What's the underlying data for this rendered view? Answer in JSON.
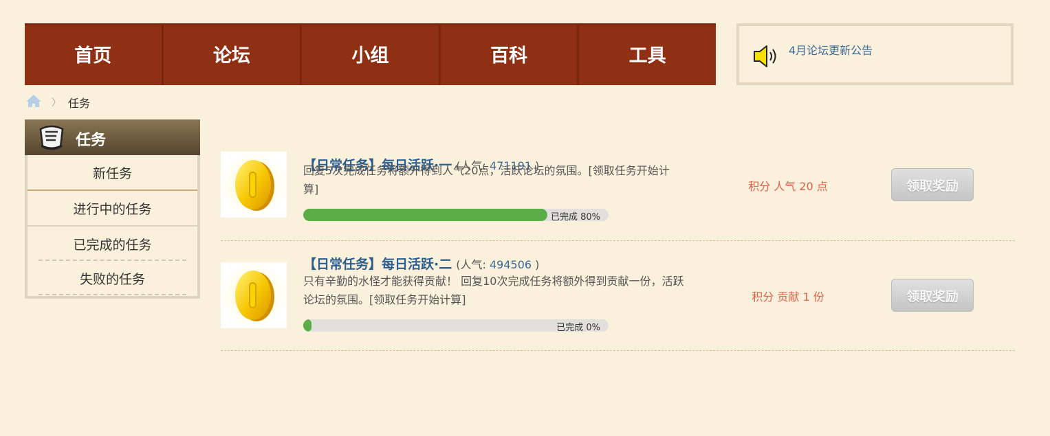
{
  "nav": {
    "items": [
      {
        "label": "首页"
      },
      {
        "label": "论坛"
      },
      {
        "label": "小组"
      },
      {
        "label": "百科"
      },
      {
        "label": "工具"
      }
    ]
  },
  "notice": {
    "icon": "speaker-icon",
    "link_text": "4月论坛更新公告"
  },
  "breadcrumb": {
    "home_icon": "home-icon",
    "current": "任务"
  },
  "sidebar": {
    "title": "任务",
    "icon": "task-badge-icon",
    "items": [
      {
        "label": "新任务"
      },
      {
        "label": "进行中的任务"
      },
      {
        "label": "已完成的任务"
      },
      {
        "label": "失败的任务"
      }
    ]
  },
  "tasks": [
    {
      "icon": "gold-coin-icon",
      "name": "【日常任务】每日活跃·一",
      "pop_prefix": "(人气: ",
      "pop_value": "471191",
      "pop_suffix": " )",
      "description": "回复5次完成任务将额外得到人气20点，活跃论坛的氛围。[领取任务开始计算]",
      "progress": 0.8,
      "progress_text": "已完成 80%",
      "reward": "积分 人气 20 点",
      "claim_label": "领取奖励"
    },
    {
      "icon": "gold-coin-icon",
      "name": "【日常任务】每日活跃·二",
      "pop_prefix": "(人气: ",
      "pop_value": "494506",
      "pop_suffix": " )",
      "description": "只有辛勤的水怪才能获得贡献！ 回复10次完成任务将额外得到贡献一份，活跃论坛的氛围。[领取任务开始计算]",
      "progress": 0,
      "progress_text": "已完成 0%",
      "reward": "积分 贡献 1 份",
      "claim_label": "领取奖励"
    }
  ],
  "colors": {
    "nav_bg": "#8f3015",
    "page_bg": "#faf1dc",
    "progress_fill": "#5bad48",
    "reward_text": "#e2604a",
    "link": "#2d5f8e"
  }
}
